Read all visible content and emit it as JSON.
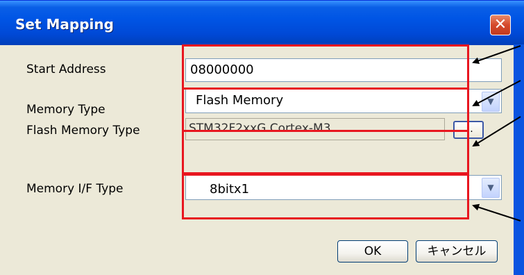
{
  "window": {
    "title": "Set Mapping",
    "close_symbol": "✕"
  },
  "fields": {
    "start_address": {
      "label": "Start Address",
      "value": "08000000"
    },
    "memory_type": {
      "label": "Memory Type",
      "value": "Flash Memory"
    },
    "flash_memory_type": {
      "label": "Flash Memory Type",
      "value": "STM32F2xxG Cortex-M3",
      "browse_label": "..."
    },
    "memory_if_type": {
      "label": "Memory I/F Type",
      "value": "8bitx1"
    }
  },
  "buttons": {
    "ok": "OK",
    "cancel": "キャンセル"
  },
  "colors": {
    "highlight": "#e8161f",
    "title_bar": "#0055e5",
    "dialog_bg": "#ece9d8"
  },
  "icons": {
    "dropdown": "chevron-down-icon",
    "close": "close-icon"
  }
}
